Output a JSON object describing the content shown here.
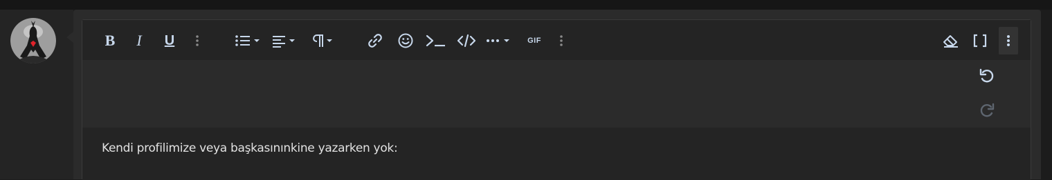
{
  "avatar": {
    "alt": "user avatar"
  },
  "toolbar": {
    "bold": "B",
    "italic": "I",
    "underline": "U",
    "gif": "GIF",
    "icon_color": "#c8d8ec",
    "buttons": [
      "bold",
      "italic",
      "underline",
      "more-text",
      "list",
      "align",
      "paragraph",
      "link",
      "emoji",
      "code-inline",
      "code-block",
      "insert-more",
      "gif",
      "more-insert",
      "remove-format",
      "bbcode-toggle",
      "more-options"
    ]
  },
  "history": {
    "undo": "undo-icon",
    "redo": "redo-icon"
  },
  "editor": {
    "text": "Kendi profilimize veya başkasınınkine yazarken yok:"
  }
}
